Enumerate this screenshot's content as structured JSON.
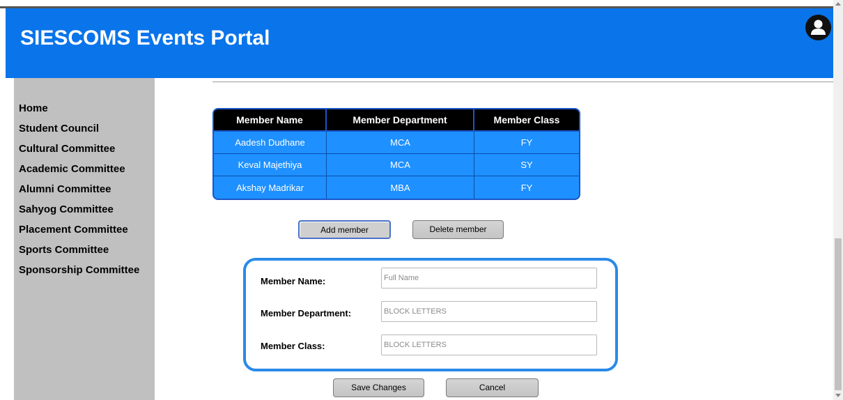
{
  "header": {
    "title": "SIESCOMS Events Portal",
    "avatar_icon": "user-icon",
    "background_color": "#0a74ea"
  },
  "sidebar": {
    "items": [
      {
        "label": "Home"
      },
      {
        "label": "Student Council"
      },
      {
        "label": "Cultural Committee"
      },
      {
        "label": "Academic Committee"
      },
      {
        "label": "Alumni Committee"
      },
      {
        "label": "Sahyog Committee"
      },
      {
        "label": "Placement Committee"
      },
      {
        "label": "Sports Committee"
      },
      {
        "label": "Sponsorship Committee"
      }
    ]
  },
  "members_table": {
    "columns": [
      "Member Name",
      "Member Department",
      "Member Class"
    ],
    "rows": [
      [
        "Aadesh Dudhane",
        "MCA",
        "FY"
      ],
      [
        "Keval Majethiya",
        "MCA",
        "SY"
      ],
      [
        "Akshay Madrikar",
        "MBA",
        "FY"
      ]
    ]
  },
  "actions": {
    "add_label": "Add member",
    "delete_label": "Delete member"
  },
  "form": {
    "name_label": "Member Name:",
    "name_placeholder": "Full Name",
    "name_value": "",
    "department_label": "Member Department:",
    "department_placeholder": "BLOCK LETTERS",
    "department_value": "",
    "class_label": "Member Class:",
    "class_placeholder": "BLOCK LETTERS",
    "class_value": ""
  },
  "footer_actions": {
    "save_label": "Save Changes",
    "cancel_label": "Cancel"
  },
  "colors": {
    "table_cell": "#1e90ff",
    "form_border": "#2a8ae8",
    "sidebar_bg": "#c0c0c0"
  }
}
